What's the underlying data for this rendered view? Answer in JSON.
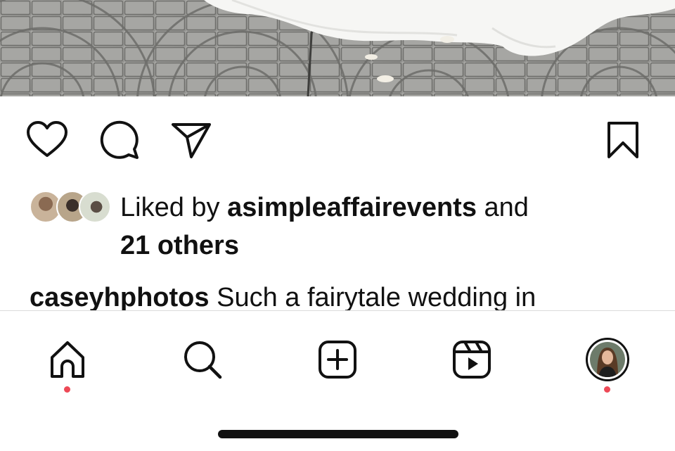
{
  "post": {
    "photo_alt": "wedding dress on paving stones",
    "actions": [
      {
        "name": "like",
        "icon": "heart-icon"
      },
      {
        "name": "comment",
        "icon": "comment-icon"
      },
      {
        "name": "share",
        "icon": "send-icon"
      },
      {
        "name": "save",
        "icon": "bookmark-icon"
      }
    ],
    "likes": {
      "prefix": "Liked by",
      "user": "asimpleaffairevents",
      "conjunction": "and",
      "others": "21 others"
    },
    "caption": {
      "user": "caseyhphotos",
      "text": "Such a fairytale wedding in"
    }
  },
  "tabbar": {
    "items": [
      {
        "name": "home",
        "icon": "home-icon",
        "notification": true
      },
      {
        "name": "search",
        "icon": "search-icon",
        "notification": false
      },
      {
        "name": "create",
        "icon": "add-post-icon",
        "notification": false
      },
      {
        "name": "reels",
        "icon": "reels-icon",
        "notification": false
      },
      {
        "name": "profile",
        "icon": "profile-avatar",
        "notification": true
      }
    ]
  },
  "colors": {
    "text": "#111111",
    "notification_dot": "#ed4956",
    "divider": "#dbdbdb"
  }
}
